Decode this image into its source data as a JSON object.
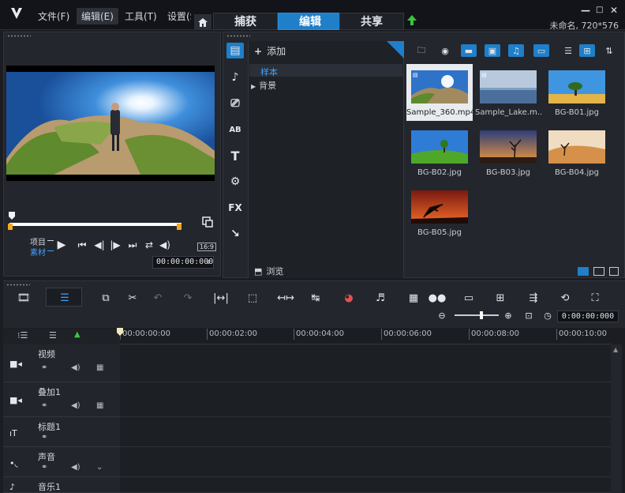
{
  "menu": [
    "文件(F)",
    "编辑(E)",
    "工具(T)",
    "设置(S)"
  ],
  "main_tabs": [
    "捕获",
    "编辑",
    "共享"
  ],
  "project_info": "未命名, 720*576",
  "window_controls": [
    "—",
    "□",
    "✕"
  ],
  "preview": {
    "mode_project": "项目",
    "mode_clip": "素材",
    "aspect": "16:9",
    "timecode": "00:00:00:000"
  },
  "library": {
    "add_label": "添加",
    "tree": [
      "样本",
      "背景"
    ],
    "browse_label": "浏览",
    "sidebar_icons": [
      "media-icon",
      "instant-project-icon",
      "transition-icon",
      "title-icon",
      "text-icon",
      "graphics-icon",
      "fx-icon",
      "path-icon"
    ],
    "fx_label": "FX",
    "items": [
      {
        "caption": "Sample_360.mp4",
        "selected": true
      },
      {
        "caption": "Sample_Lake.m...",
        "selected": false
      },
      {
        "caption": "BG-B01.jpg",
        "selected": false
      },
      {
        "caption": "BG-B02.jpg",
        "selected": false
      },
      {
        "caption": "BG-B03.jpg",
        "selected": false
      },
      {
        "caption": "BG-B04.jpg",
        "selected": false
      },
      {
        "caption": "BG-B05.jpg",
        "selected": false
      }
    ]
  },
  "timeline": {
    "time_display": "0:00:00:000",
    "ruler": [
      "00:00:00:00",
      "00:00:02:00",
      "00:00:04:00",
      "00:00:06:00",
      "00:00:08:00",
      "00:00:10:00"
    ],
    "tracks": [
      {
        "name": "视频"
      },
      {
        "name": "叠加1"
      },
      {
        "name": "标题1"
      },
      {
        "name": "声音"
      },
      {
        "name": "音乐1"
      }
    ]
  },
  "colors": {
    "accent": "#1f7fc9",
    "clip_label": "#3ea0ff",
    "marker": "#f5a623"
  }
}
